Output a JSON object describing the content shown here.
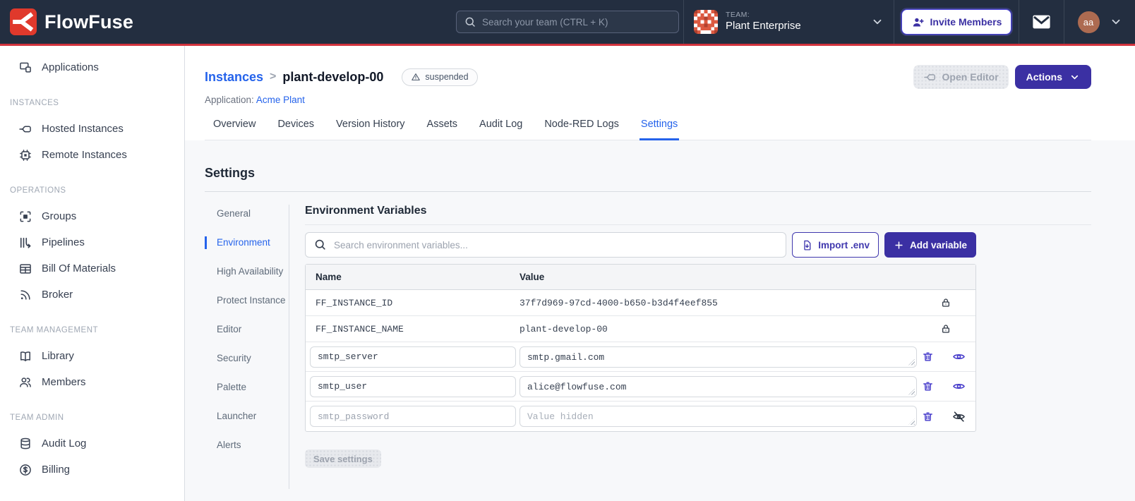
{
  "colors": {
    "navbar_bg": "#232e40",
    "accent_red_line": "#d2333d",
    "brand_red": "#e0392c",
    "indigo_button": "#3b30a3",
    "link_blue": "#2563eb",
    "user_avatar_bg": "#ad6b51",
    "team_avatar_bg": "#dd5a41",
    "page_bg": "#f7f8fa"
  },
  "navbar": {
    "brand": "FlowFuse",
    "search": {
      "placeholder": "Search your team (CTRL + K)"
    },
    "team": {
      "label": "TEAM:",
      "name": "Plant Enterprise"
    },
    "invite_label": "Invite Members",
    "avatar_initials": "aa"
  },
  "sidebar": {
    "top_item": {
      "label": "Applications"
    },
    "sections": [
      {
        "title": "INSTANCES",
        "items": [
          {
            "label": "Hosted Instances"
          },
          {
            "label": "Remote Instances"
          }
        ]
      },
      {
        "title": "OPERATIONS",
        "items": [
          {
            "label": "Groups"
          },
          {
            "label": "Pipelines"
          },
          {
            "label": "Bill Of Materials"
          },
          {
            "label": "Broker"
          }
        ]
      },
      {
        "title": "TEAM MANAGEMENT",
        "items": [
          {
            "label": "Library"
          },
          {
            "label": "Members"
          }
        ]
      },
      {
        "title": "TEAM ADMIN",
        "items": [
          {
            "label": "Audit Log"
          },
          {
            "label": "Billing"
          }
        ]
      }
    ]
  },
  "header": {
    "breadcrumb_parent": "Instances",
    "breadcrumb_separator": ">",
    "breadcrumb_current": "plant-develop-00",
    "status_badge": "suspended",
    "application_label": "Application:",
    "application_name": "Acme Plant",
    "open_editor_label": "Open Editor",
    "actions_label": "Actions"
  },
  "tabs": [
    {
      "label": "Overview"
    },
    {
      "label": "Devices"
    },
    {
      "label": "Version History"
    },
    {
      "label": "Assets"
    },
    {
      "label": "Audit Log"
    },
    {
      "label": "Node-RED Logs"
    },
    {
      "label": "Settings",
      "active": true
    }
  ],
  "settings": {
    "title": "Settings",
    "nav": [
      {
        "label": "General"
      },
      {
        "label": "Environment",
        "active": true
      },
      {
        "label": "High Availability"
      },
      {
        "label": "Protect Instance"
      },
      {
        "label": "Editor"
      },
      {
        "label": "Security"
      },
      {
        "label": "Palette"
      },
      {
        "label": "Launcher"
      },
      {
        "label": "Alerts"
      }
    ],
    "section_title": "Environment Variables",
    "search_placeholder": "Search environment variables...",
    "import_button": "Import .env",
    "add_button": "Add variable",
    "table": {
      "columns": [
        "Name",
        "Value"
      ],
      "locked_rows": [
        {
          "name": "FF_INSTANCE_ID",
          "value": "37f7d969-97cd-4000-b650-b3d4f4eef855"
        },
        {
          "name": "FF_INSTANCE_NAME",
          "value": "plant-develop-00"
        }
      ],
      "editable_rows": [
        {
          "name": "smtp_server",
          "value": "smtp.gmail.com",
          "hidden": false
        },
        {
          "name": "smtp_user",
          "value": "alice@flowfuse.com",
          "hidden": false
        },
        {
          "name": "smtp_password",
          "value": "",
          "value_placeholder": "Value hidden",
          "hidden": true
        }
      ]
    },
    "save_button": "Save settings"
  }
}
